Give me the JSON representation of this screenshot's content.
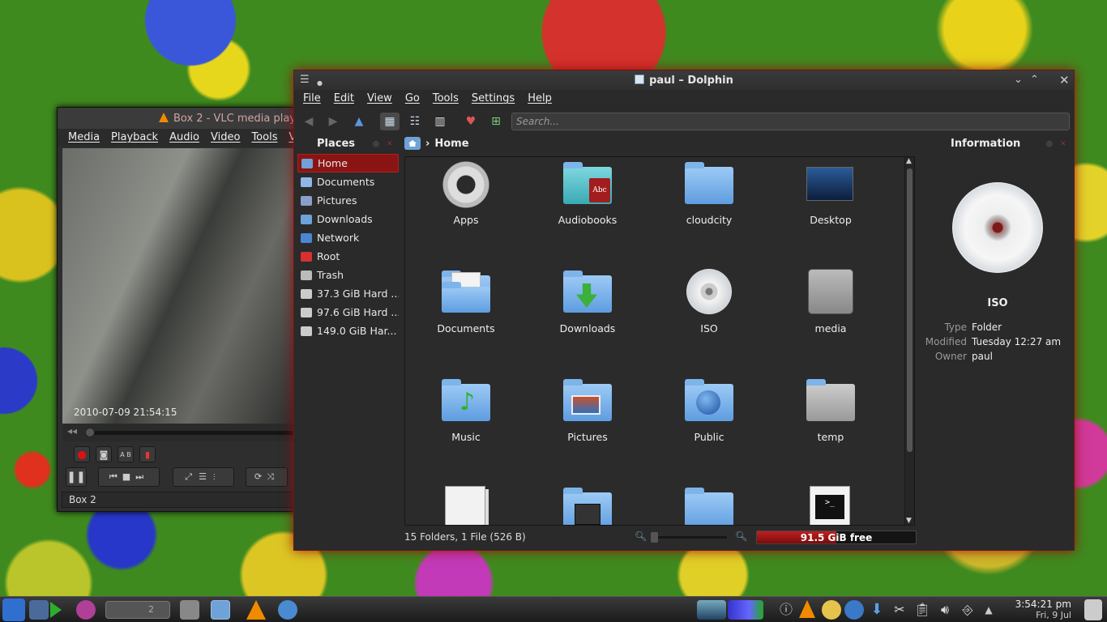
{
  "vlc": {
    "title": "Box 2 - VLC media play",
    "menu": [
      "Media",
      "Playback",
      "Audio",
      "Video",
      "Tools",
      "Vie"
    ],
    "timestamp": "2010-07-09 21:54:15",
    "status": "Box 2"
  },
  "dolphin": {
    "title": "paul – Dolphin",
    "menu": [
      "File",
      "Edit",
      "View",
      "Go",
      "Tools",
      "Settings",
      "Help"
    ],
    "search_placeholder": "Search...",
    "places_header": "Places",
    "places": [
      {
        "label": "Home",
        "icon": "home-icon",
        "active": true,
        "color": "#6fa2d8"
      },
      {
        "label": "Documents",
        "icon": "documents-icon",
        "active": false,
        "color": "#8fb8e8"
      },
      {
        "label": "Pictures",
        "icon": "pictures-icon",
        "active": false,
        "color": "#8aa0c8"
      },
      {
        "label": "Downloads",
        "icon": "downloads-icon",
        "active": false,
        "color": "#6fa2d8"
      },
      {
        "label": "Network",
        "icon": "network-icon",
        "active": false,
        "color": "#4a86d4"
      },
      {
        "label": "Root",
        "icon": "root-folder-icon",
        "active": false,
        "color": "#d83030"
      },
      {
        "label": "Trash",
        "icon": "trash-icon",
        "active": false,
        "color": "#bbbbbb"
      },
      {
        "label": "37.3 GiB Hard ...",
        "icon": "hard-drive-icon",
        "active": false,
        "color": "#cccccc"
      },
      {
        "label": "97.6 GiB Hard ...",
        "icon": "hard-drive-icon",
        "active": false,
        "color": "#cccccc"
      },
      {
        "label": "149.0 GiB Har...",
        "icon": "hard-drive-icon",
        "active": false,
        "color": "#cccccc"
      }
    ],
    "breadcrumb": "Home",
    "items": [
      {
        "label": "Apps",
        "icon": "gear-icon"
      },
      {
        "label": "Audiobooks",
        "icon": "audiobooks-folder-icon"
      },
      {
        "label": "cloudcity",
        "icon": "folder-icon"
      },
      {
        "label": "Desktop",
        "icon": "desktop-icon"
      },
      {
        "label": "Documents",
        "icon": "documents-folder-icon"
      },
      {
        "label": "Downloads",
        "icon": "downloads-folder-icon"
      },
      {
        "label": "ISO",
        "icon": "cd-icon"
      },
      {
        "label": "media",
        "icon": "hard-drive-icon"
      },
      {
        "label": "Music",
        "icon": "music-folder-icon"
      },
      {
        "label": "Pictures",
        "icon": "pictures-folder-icon"
      },
      {
        "label": "Public",
        "icon": "public-folder-icon"
      },
      {
        "label": "temp",
        "icon": "grey-folder-icon"
      },
      {
        "label": "",
        "icon": "file-icon"
      },
      {
        "label": "",
        "icon": "videos-folder-icon"
      },
      {
        "label": "",
        "icon": "folder-icon"
      },
      {
        "label": "",
        "icon": "terminal-icon"
      }
    ],
    "status": "15 Folders, 1 File (526 B)",
    "free_space": "91.5 GiB free",
    "free_used_fraction": 0.5,
    "info": {
      "header": "Information",
      "name": "ISO",
      "type_label": "Type",
      "type_value": "Folder",
      "modified_label": "Modified",
      "modified_value": "Tuesday 12:27 am",
      "owner_label": "Owner",
      "owner_value": "paul"
    }
  },
  "taskbar": {
    "pager_number": "2",
    "time": "3:54:21 pm",
    "date": "Fri, 9 Jul"
  },
  "colors": {
    "accent": "#8a1414",
    "folder": "#6fa2d8",
    "vlc_orange": "#f08a00"
  }
}
